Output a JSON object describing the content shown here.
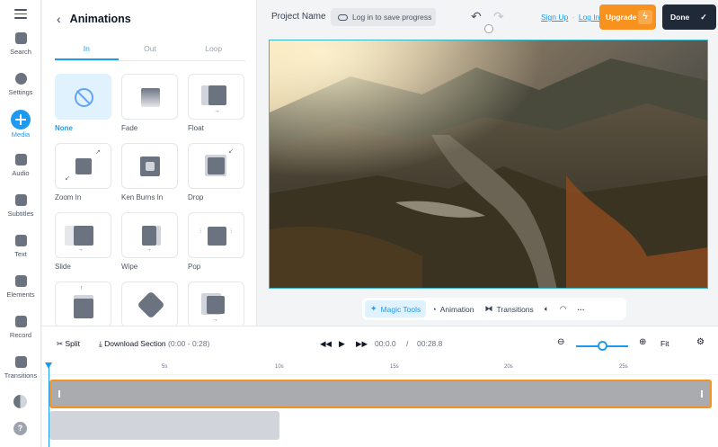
{
  "rail": {
    "items": [
      {
        "label": "Search",
        "icon": "search-icon"
      },
      {
        "label": "Settings",
        "icon": "gear-icon"
      },
      {
        "label": "Media",
        "icon": "plus-icon"
      },
      {
        "label": "Audio",
        "icon": "music-icon"
      },
      {
        "label": "Subtitles",
        "icon": "subtitles-icon"
      },
      {
        "label": "Text",
        "icon": "text-icon"
      },
      {
        "label": "Elements",
        "icon": "elements-icon"
      },
      {
        "label": "Record",
        "icon": "record-icon"
      },
      {
        "label": "Transitions",
        "icon": "transitions-icon"
      }
    ]
  },
  "panel": {
    "title": "Animations",
    "tabs": [
      "In",
      "Out",
      "Loop"
    ],
    "active_tab": "In",
    "animations": [
      "None",
      "Fade",
      "Float",
      "Zoom In",
      "Ken Burns In",
      "Drop",
      "Slide",
      "Wipe",
      "Pop"
    ],
    "selected": "None"
  },
  "topbar": {
    "project_name": "Project Name",
    "save_prompt": "Log in to save progress",
    "sign_up": "Sign Up",
    "separator": "·",
    "log_in": "Log In",
    "upgrade": "Upgrade",
    "done": "Done"
  },
  "magic_bar": {
    "magic_tools": "Magic Tools",
    "animation": "Animation",
    "transitions": "Transitions"
  },
  "timeline_bar": {
    "split": "Split",
    "download": "Download Section",
    "range": "(0:00 - 0:28)",
    "current_time": "00:0.0",
    "time_sep": "/",
    "total_time": "00:28.8",
    "fit": "Fit",
    "zoom_level": 0.5
  },
  "ruler": {
    "labels": [
      "5s",
      "10s",
      "15s",
      "20s",
      "25s"
    ]
  },
  "colors": {
    "accent": "#1d9bf0",
    "upgrade": "#f7921e",
    "done": "#1f2937",
    "selection": "#3ab6c8"
  }
}
